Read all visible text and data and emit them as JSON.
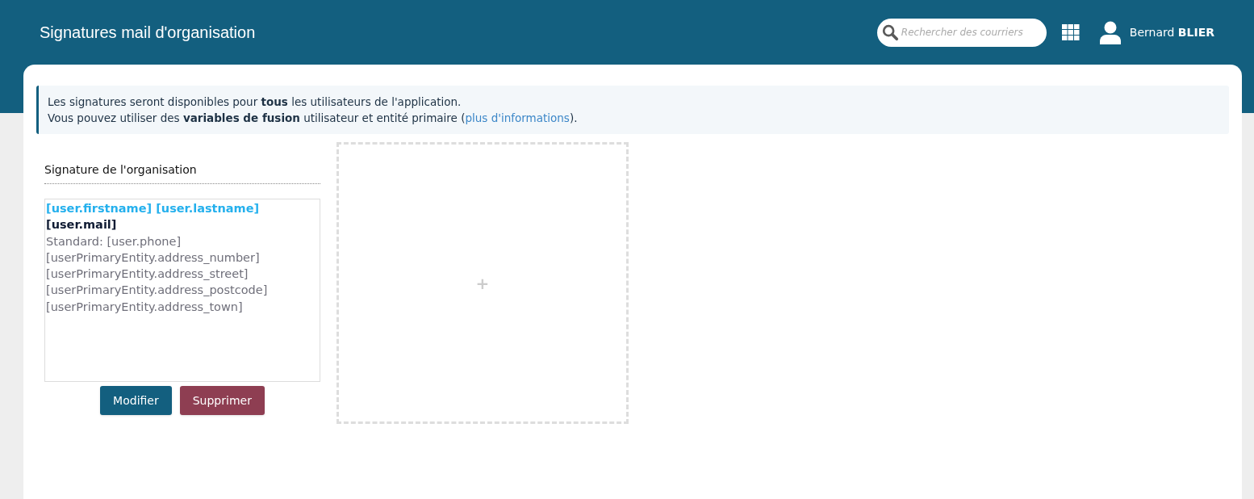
{
  "header": {
    "title": "Signatures mail d'organisation",
    "search": {
      "placeholder": "Rechercher des courriers"
    },
    "user": {
      "first_name": "Bernard",
      "last_name": "BLIER"
    }
  },
  "info": {
    "line_1": "Les signatures seront disponibles pour **tous** les utilisateurs de l'application.",
    "line_2_before": "Vous pouvez utiliser des **variables de fusion** utilisateur et entité primaire (",
    "line_2_link": "plus d'informations",
    "line_2_after": ")."
  },
  "signature": {
    "title": "Signature de l'organisation",
    "lines": [
      {
        "kind": "name",
        "text": "[user.firstname] [user.lastname]"
      },
      {
        "kind": "mail",
        "text": "[user.mail]"
      },
      {
        "kind": "plain",
        "text": "Standard: [user.phone]"
      },
      {
        "kind": "plain",
        "text": "[userPrimaryEntity.address_number]"
      },
      {
        "kind": "plain",
        "text": "[userPrimaryEntity.address_street]"
      },
      {
        "kind": "plain",
        "text": "[userPrimaryEntity.address_postcode]"
      },
      {
        "kind": "plain",
        "text": "[userPrimaryEntity.address_town]"
      }
    ],
    "buttons": [
      {
        "kind": "primary",
        "label": "Modifier"
      },
      {
        "kind": "danger",
        "label": "Supprimer"
      }
    ],
    "add_tile": {
      "label": "+"
    }
  }
}
